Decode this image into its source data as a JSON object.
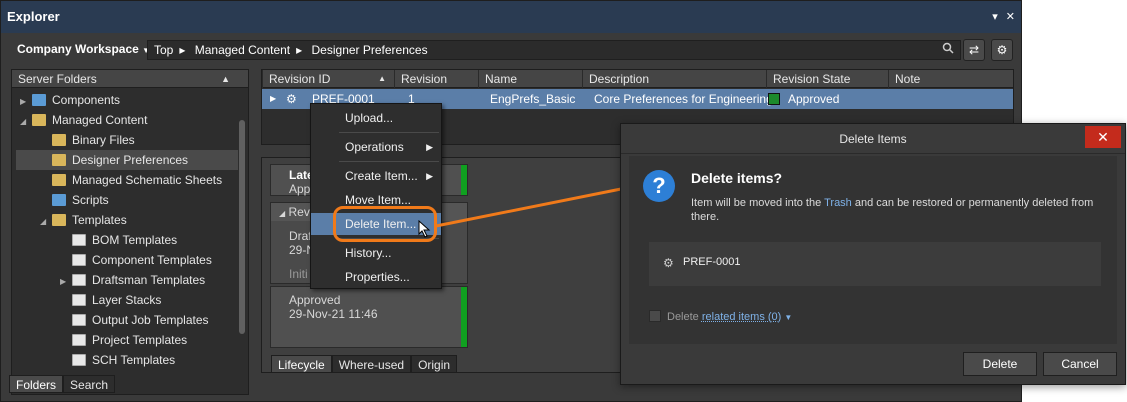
{
  "explorer": {
    "title": "Explorer",
    "window_controls": [
      "▾",
      "✕"
    ],
    "workspace_label": "Company Workspace",
    "breadcrumb": [
      "Top",
      "Managed Content",
      "Designer Preferences"
    ]
  },
  "folders": {
    "header": "Server Folders",
    "items": [
      {
        "label": "Components",
        "depth": 0,
        "expander": "▶",
        "icon": "components-icon"
      },
      {
        "label": "Managed Content",
        "depth": 0,
        "expander": "◢",
        "icon": "folder-icon"
      },
      {
        "label": "Binary Files",
        "depth": 1,
        "expander": "",
        "icon": "folder-icon"
      },
      {
        "label": "Designer Preferences",
        "depth": 1,
        "expander": "",
        "icon": "preferences-icon",
        "selected": true
      },
      {
        "label": "Managed Schematic Sheets",
        "depth": 1,
        "expander": "",
        "icon": "folder-icon"
      },
      {
        "label": "Scripts",
        "depth": 1,
        "expander": "",
        "icon": "scripts-icon"
      },
      {
        "label": "Templates",
        "depth": 1,
        "expander": "◢",
        "icon": "folder-icon"
      },
      {
        "label": "BOM Templates",
        "depth": 2,
        "expander": "",
        "icon": "template-icon"
      },
      {
        "label": "Component Templates",
        "depth": 2,
        "expander": "",
        "icon": "template-icon"
      },
      {
        "label": "Draftsman Templates",
        "depth": 2,
        "expander": "▶",
        "icon": "template-icon"
      },
      {
        "label": "Layer Stacks",
        "depth": 2,
        "expander": "",
        "icon": "template-icon"
      },
      {
        "label": "Output Job Templates",
        "depth": 2,
        "expander": "",
        "icon": "template-icon"
      },
      {
        "label": "Project Templates",
        "depth": 2,
        "expander": "",
        "icon": "template-icon"
      },
      {
        "label": "SCH Templates",
        "depth": 2,
        "expander": "",
        "icon": "template-icon"
      }
    ],
    "tabs": [
      "Folders",
      "Search"
    ]
  },
  "grid": {
    "columns": [
      "Revision ID",
      "Revision",
      "Name",
      "Description",
      "Revision State",
      "Note"
    ],
    "row": {
      "revision_id": "PREF-0001",
      "revision": "1",
      "name": "EngPrefs_Basic",
      "description": "Core Preferences for Engineering",
      "state": "Approved"
    }
  },
  "lifecycle": {
    "latest_label": "Late",
    "latest_sub": "App",
    "rev_header": "Rev.",
    "draft_label": "Draf",
    "draft_date": "29-N",
    "initial_label": "Initi",
    "approved_label": "Approved",
    "approved_date": "29-Nov-21 11:46",
    "tabs": [
      "Lifecycle",
      "Where-used",
      "Origin"
    ]
  },
  "context_menu": {
    "items": [
      "Upload...",
      "Operations",
      "Create Item...",
      "Move Item...",
      "Delete Item...",
      "History...",
      "Properties..."
    ]
  },
  "dialog": {
    "title": "Delete Items",
    "heading": "Delete items?",
    "message_prefix": "Item will be moved into the ",
    "message_link": "Trash",
    "message_suffix": " and can be restored or permanently deleted from there.",
    "item": "PREF-0001",
    "related_prefix": "Delete",
    "related_link": "related items (0)",
    "delete_button": "Delete",
    "cancel_button": "Cancel"
  },
  "colors": {
    "accent": "#f07a1a",
    "selection": "#5b7ea8",
    "approved": "#1c8a2c",
    "close_red": "#c42b1c"
  }
}
